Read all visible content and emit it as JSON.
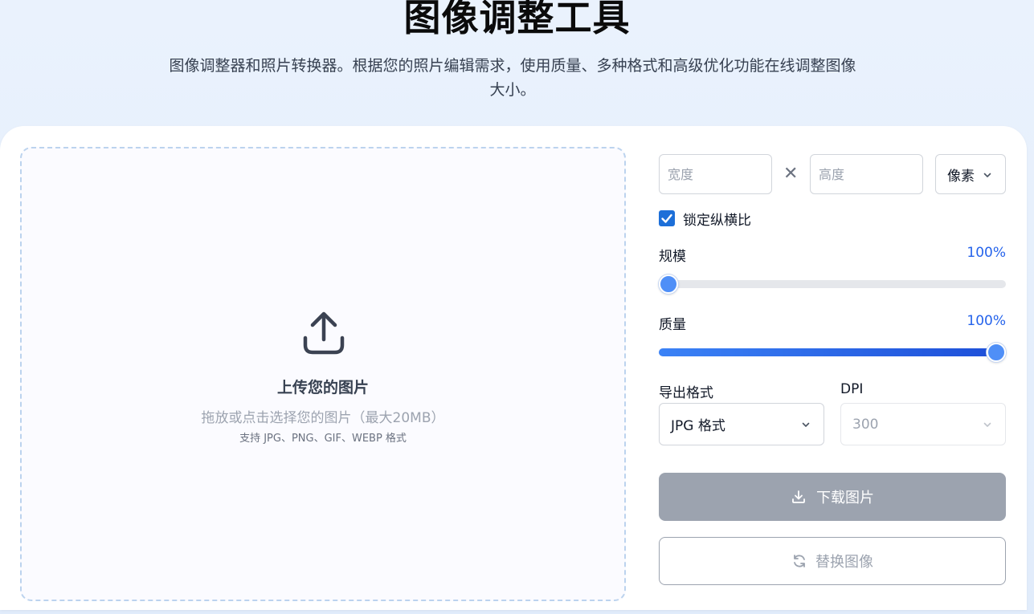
{
  "header": {
    "title": "图像调整工具",
    "subtitle": "图像调整器和照片转换器。根据您的照片编辑需求，使用质量、多种格式和高级优化功能在线调整图像大小。"
  },
  "upload": {
    "icon": "upload-icon",
    "title": "上传您的图片",
    "hint": "拖放或点击选择您的图片（最大20MB）",
    "formats": "支持 JPG、PNG、GIF、WEBP 格式"
  },
  "dimensions": {
    "width_placeholder": "宽度",
    "height_placeholder": "高度",
    "separator": "✕",
    "unit": "像素"
  },
  "lock_ratio": {
    "label": "锁定纵横比",
    "checked": true
  },
  "scale": {
    "label": "规模",
    "value": "100%",
    "fraction": 0
  },
  "quality": {
    "label": "质量",
    "value": "100%",
    "fraction": 1
  },
  "export": {
    "format_label": "导出格式",
    "format_value": "JPG 格式"
  },
  "dpi": {
    "label": "DPI",
    "value": "300"
  },
  "actions": {
    "download": "下载图片",
    "replace": "替换图像"
  },
  "colors": {
    "accent": "#2563eb",
    "disabled_button": "#9ca3af"
  }
}
